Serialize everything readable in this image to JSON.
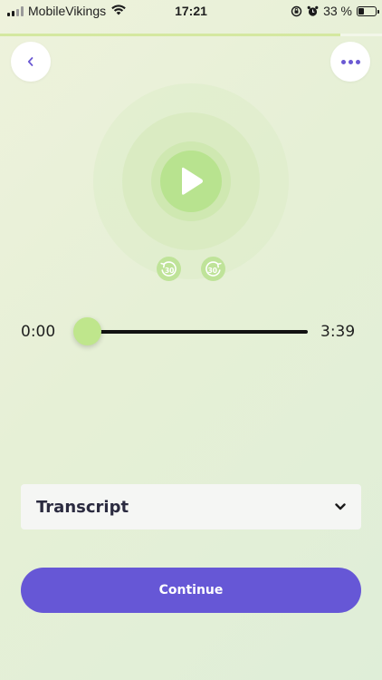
{
  "status_bar": {
    "carrier": "MobileVikings",
    "time": "17:21",
    "battery_percent": "33 %",
    "icons": [
      "signal-icon",
      "wifi-icon",
      "orientation-lock-icon",
      "alarm-icon",
      "battery-icon"
    ]
  },
  "lesson_progress": {
    "fraction": 0.89
  },
  "header": {
    "back_icon": "chevron-left-icon",
    "more_icon": "more-dots-icon"
  },
  "player": {
    "play_icon": "play-icon",
    "rewind_icon": "rewind-30-icon",
    "rewind_label": "30",
    "forward_icon": "forward-30-icon",
    "forward_label": "30",
    "current_time": "0:00",
    "total_time": "3:39",
    "position_fraction": 0.0
  },
  "transcript": {
    "label": "Transcript",
    "icon": "chevron-down-icon"
  },
  "continue": {
    "label": "Continue"
  },
  "colors": {
    "accent": "#6657d6",
    "play_green": "#b8e38f",
    "thumb_green": "#bfe68c",
    "progress_fill": "#d4e8a0"
  }
}
